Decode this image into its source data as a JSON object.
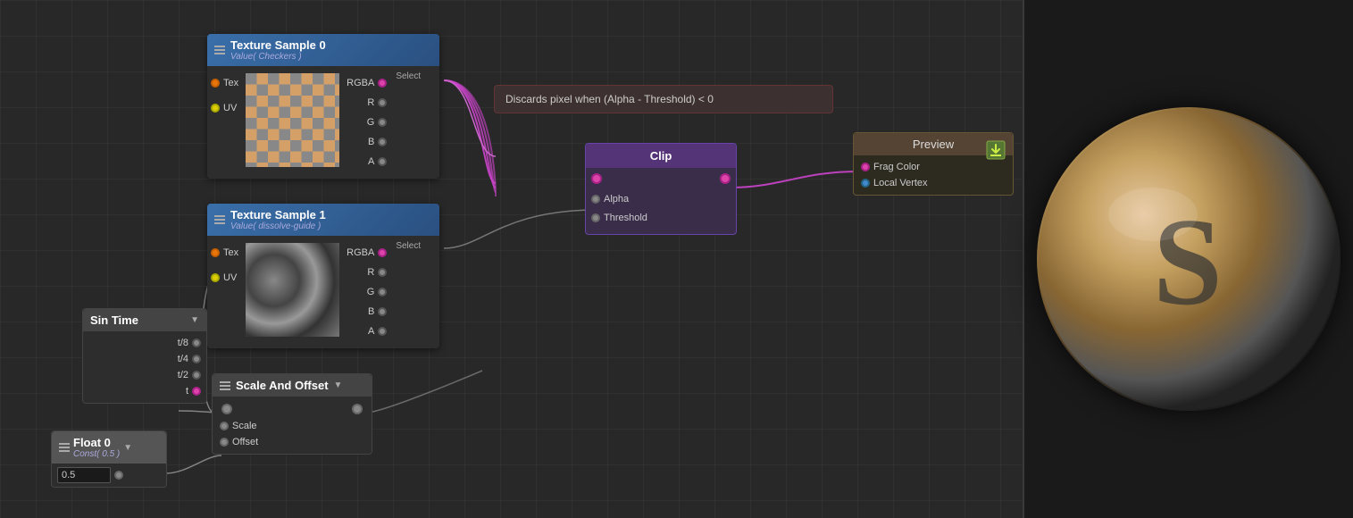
{
  "nodes": {
    "texture0": {
      "title": "Texture Sample 0",
      "subtitle": "Value( Checkers )",
      "left_ports": [
        "Tex",
        "UV"
      ],
      "right_ports": [
        "RGBA",
        "R",
        "G",
        "B",
        "A"
      ],
      "select_label": "Select"
    },
    "texture1": {
      "title": "Texture Sample 1",
      "subtitle": "Value( dissolve-guide )",
      "left_ports": [
        "Tex",
        "UV"
      ],
      "right_ports": [
        "RGBA",
        "R",
        "G",
        "B",
        "A"
      ],
      "select_label": "Select"
    },
    "sintime": {
      "title": "Sin Time",
      "ports": [
        "t/8",
        "t/4",
        "t/2",
        "t"
      ]
    },
    "scale_offset": {
      "title": "Scale And Offset",
      "input_ports": [
        "(left)",
        "(right)"
      ],
      "output_ports": [
        "Scale",
        "Offset"
      ]
    },
    "float0": {
      "title": "Float 0",
      "subtitle": "Const( 0.5 )",
      "value": "0.5"
    },
    "discard": {
      "label": "Discards pixel when (Alpha - Threshold) < 0"
    },
    "clip": {
      "title": "Clip",
      "ports": [
        "Alpha",
        "Threshold"
      ]
    },
    "preview": {
      "title": "Preview",
      "ports": [
        "Frag Color",
        "Local Vertex"
      ]
    }
  },
  "colors": {
    "texture_header": "#3a6faa",
    "clip_header": "#553377",
    "preview_header": "#554433",
    "sintime_header": "#444444",
    "scale_header": "#444444",
    "float_header": "#555555",
    "pink_port": "#dd44aa",
    "orange_port": "#e8760a",
    "connection_color": "#cc44cc"
  }
}
